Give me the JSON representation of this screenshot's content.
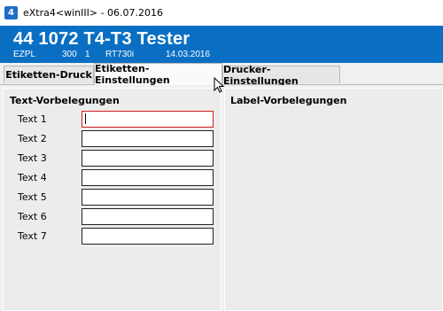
{
  "window": {
    "title": "eXtra4<winIII> - 06.07.2016",
    "icon": "app-logo-icon",
    "icon_glyph": "4"
  },
  "header": {
    "title": "44 1072 T4-T3 Tester",
    "sub": {
      "type": "EZPL",
      "value1": "300",
      "value2": "1",
      "printer": "RT730i",
      "date": "14.03.2016"
    },
    "background": "#0a6fc2"
  },
  "tabs": [
    {
      "label": "Etiketten-Druck",
      "active": false
    },
    {
      "label": "Etiketten-Einstellungen",
      "active": true
    },
    {
      "label": "Drucker-Einstellungen",
      "active": false
    }
  ],
  "left_panel": {
    "title": "Text-Vorbelegungen",
    "rows": [
      {
        "label": "Text 1",
        "value": ""
      },
      {
        "label": "Text 2",
        "value": ""
      },
      {
        "label": "Text 3",
        "value": ""
      },
      {
        "label": "Text 4",
        "value": ""
      },
      {
        "label": "Text 5",
        "value": ""
      },
      {
        "label": "Text 6",
        "value": ""
      },
      {
        "label": "Text 7",
        "value": ""
      }
    ]
  },
  "right_panel": {
    "title": "Label-Vorbelegungen"
  },
  "colors": {
    "focus_border": "#d11c1c"
  }
}
